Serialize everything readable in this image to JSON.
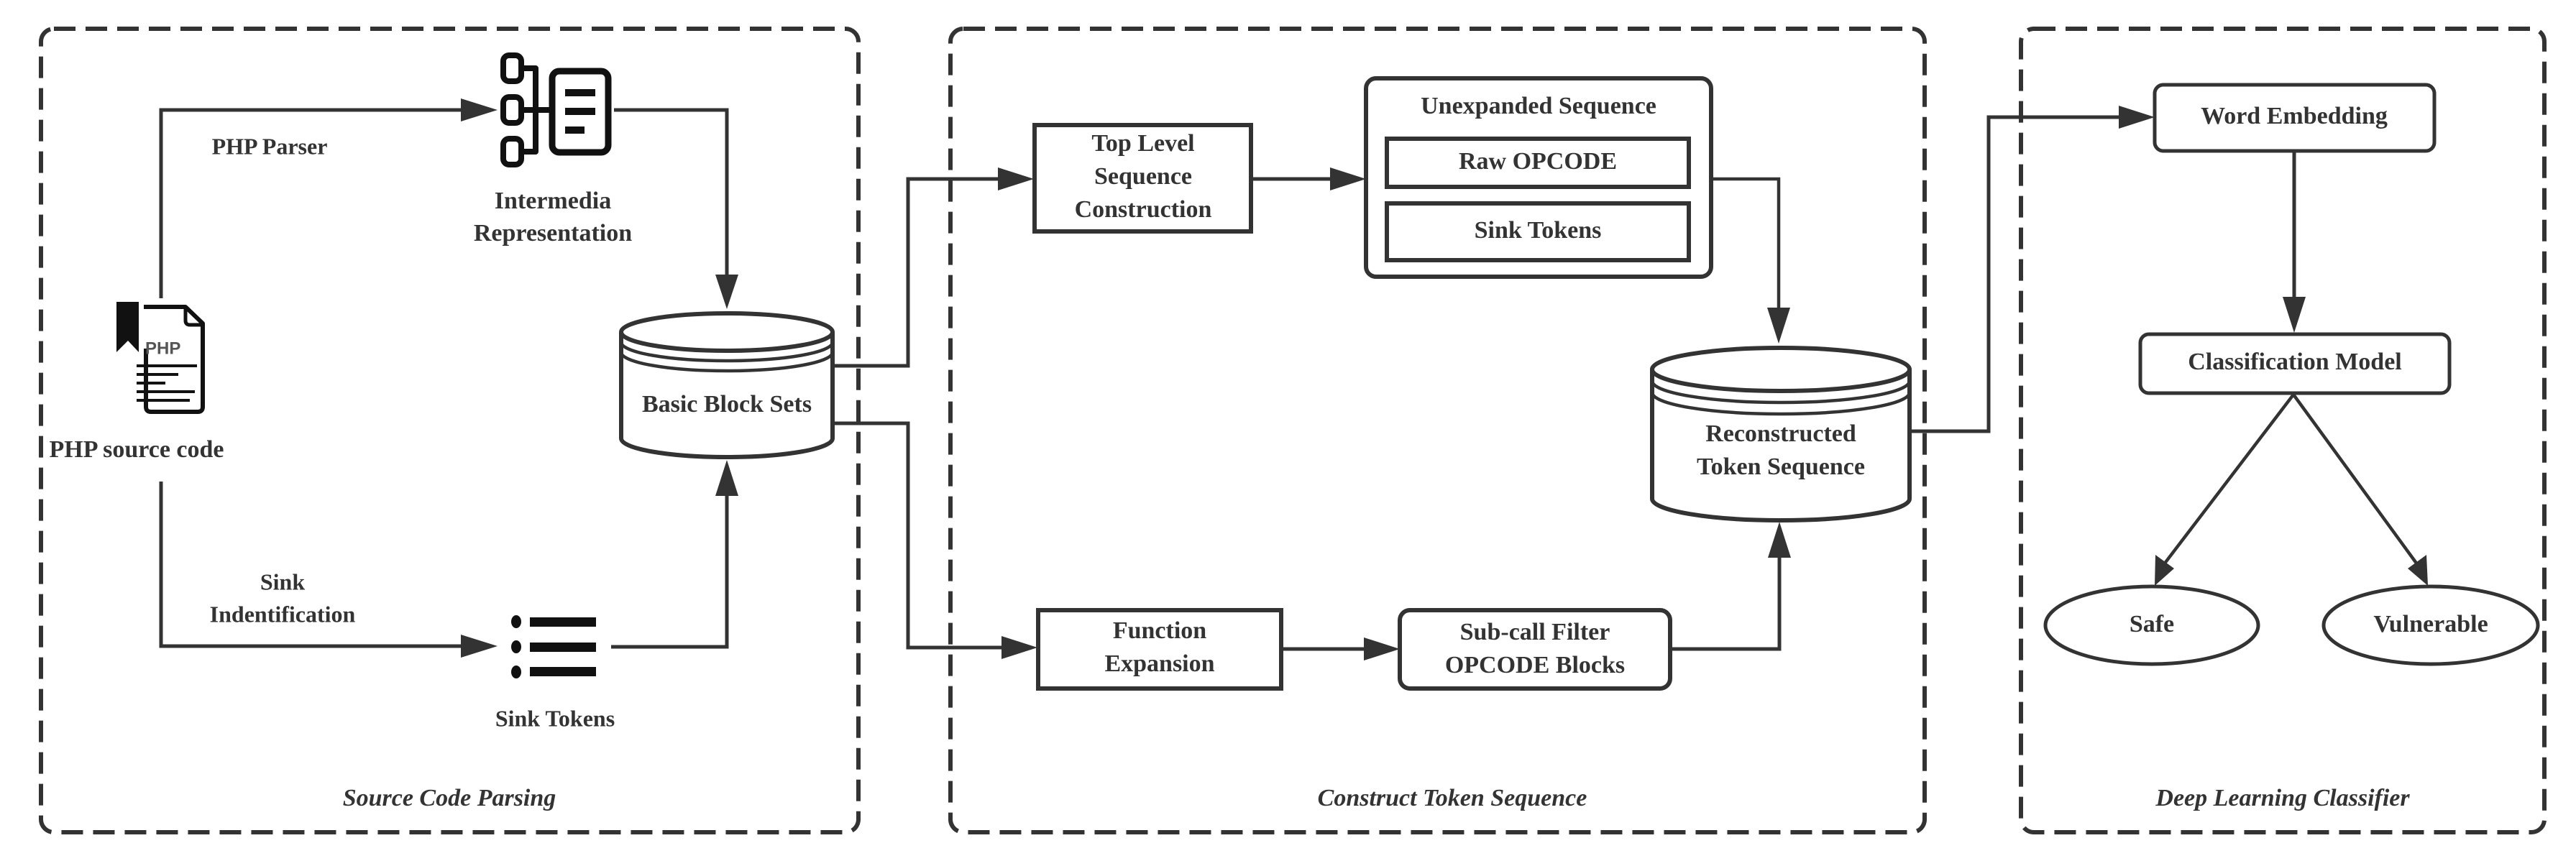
{
  "panels": {
    "source_code_parsing": {
      "title": "Source Code Parsing"
    },
    "construct_token_sequence": {
      "title": "Construct Token Sequence"
    },
    "deep_learning_classifier": {
      "title": "Deep Learning Classifier"
    }
  },
  "source_parsing": {
    "php_source": {
      "label": "PHP source code",
      "icon_text": "PHP",
      "icon": "php-file-icon"
    },
    "php_parser_edge": {
      "label": "PHP Parser"
    },
    "intermedia": {
      "label_line1": "Intermedia",
      "label_line2": "Representation",
      "icon": "tree-structure-icon"
    },
    "sink_identification_edge": {
      "label_line1": "Sink",
      "label_line2": "Indentification"
    },
    "sink_tokens": {
      "label": "Sink Tokens",
      "icon": "bullet-list-icon"
    },
    "basic_block_sets": {
      "label": "Basic Block Sets"
    }
  },
  "token_sequence": {
    "top_level": {
      "line1": "Top Level",
      "line2": "Sequence",
      "line3": "Construction"
    },
    "unexpanded": {
      "title": "Unexpanded Sequence",
      "items": [
        "Raw OPCODE",
        "Sink Tokens"
      ]
    },
    "function_expansion": {
      "line1": "Function",
      "line2": "Expansion"
    },
    "subcall_filter": {
      "line1": "Sub-call Filter",
      "line2": "OPCODE Blocks"
    },
    "reconstructed": {
      "line1": "Reconstructed",
      "line2": "Token Sequence"
    }
  },
  "classifier": {
    "word_embedding": {
      "label": "Word Embedding"
    },
    "classification_model": {
      "label": "Classification Model"
    },
    "outputs": [
      "Safe",
      "Vulnerable"
    ]
  }
}
